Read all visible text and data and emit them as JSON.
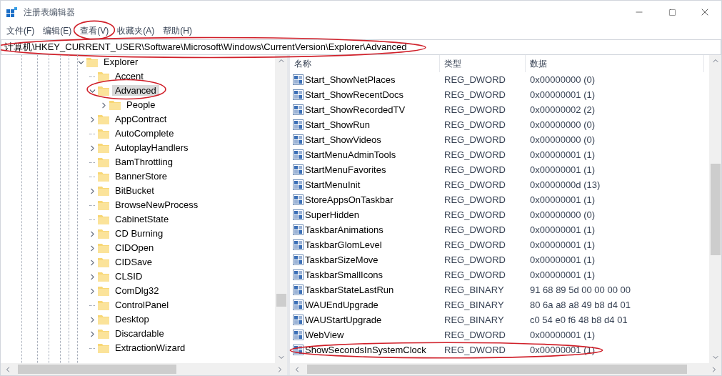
{
  "window": {
    "title": "注册表编辑器"
  },
  "menu": [
    {
      "label": "文件(F)",
      "circled": false
    },
    {
      "label": "编辑(E)",
      "circled": false
    },
    {
      "label": "查看(V)",
      "circled": true
    },
    {
      "label": "收藏夹(A)",
      "circled": false
    },
    {
      "label": "帮助(H)",
      "circled": false
    }
  ],
  "address": {
    "value": "计算机\\HKEY_CURRENT_USER\\Software\\Microsoft\\Windows\\CurrentVersion\\Explorer\\Advanced",
    "circled": true
  },
  "tree": [
    {
      "label": "Explorer",
      "kind": "branch",
      "expanded": true,
      "selected": false,
      "circled": false,
      "children": [
        {
          "label": "Accent",
          "kind": "leaf",
          "selected": false,
          "circled": false
        },
        {
          "label": "Advanced",
          "kind": "branch",
          "expanded": true,
          "selected": true,
          "circled": true,
          "children": [
            {
              "label": "People",
              "kind": "branch",
              "expanded": false,
              "selected": false,
              "circled": false
            }
          ]
        },
        {
          "label": "AppContract",
          "kind": "branch",
          "expanded": false,
          "selected": false,
          "circled": false
        },
        {
          "label": "AutoComplete",
          "kind": "leaf",
          "selected": false,
          "circled": false
        },
        {
          "label": "AutoplayHandlers",
          "kind": "branch",
          "expanded": false,
          "selected": false,
          "circled": false
        },
        {
          "label": "BamThrottling",
          "kind": "leaf",
          "selected": false,
          "circled": false
        },
        {
          "label": "BannerStore",
          "kind": "leaf",
          "selected": false,
          "circled": false
        },
        {
          "label": "BitBucket",
          "kind": "branch",
          "expanded": false,
          "selected": false,
          "circled": false
        },
        {
          "label": "BrowseNewProcess",
          "kind": "leaf",
          "selected": false,
          "circled": false
        },
        {
          "label": "CabinetState",
          "kind": "leaf",
          "selected": false,
          "circled": false
        },
        {
          "label": "CD Burning",
          "kind": "branch",
          "expanded": false,
          "selected": false,
          "circled": false
        },
        {
          "label": "CIDOpen",
          "kind": "branch",
          "expanded": false,
          "selected": false,
          "circled": false
        },
        {
          "label": "CIDSave",
          "kind": "branch",
          "expanded": false,
          "selected": false,
          "circled": false
        },
        {
          "label": "CLSID",
          "kind": "branch",
          "expanded": false,
          "selected": false,
          "circled": false
        },
        {
          "label": "ComDlg32",
          "kind": "branch",
          "expanded": false,
          "selected": false,
          "circled": false
        },
        {
          "label": "ControlPanel",
          "kind": "leaf",
          "selected": false,
          "circled": false
        },
        {
          "label": "Desktop",
          "kind": "branch",
          "expanded": false,
          "selected": false,
          "circled": false
        },
        {
          "label": "Discardable",
          "kind": "branch",
          "expanded": false,
          "selected": false,
          "circled": false
        },
        {
          "label": "ExtractionWizard",
          "kind": "leaf",
          "selected": false,
          "circled": false
        }
      ]
    }
  ],
  "table": {
    "columns": [
      "名称",
      "类型",
      "数据"
    ],
    "rows": [
      {
        "name": "Start_ShowNetPlaces",
        "type": "REG_DWORD",
        "data": "0x00000000 (0)",
        "circled": false
      },
      {
        "name": "Start_ShowRecentDocs",
        "type": "REG_DWORD",
        "data": "0x00000001 (1)",
        "circled": false
      },
      {
        "name": "Start_ShowRecordedTV",
        "type": "REG_DWORD",
        "data": "0x00000002 (2)",
        "circled": false
      },
      {
        "name": "Start_ShowRun",
        "type": "REG_DWORD",
        "data": "0x00000000 (0)",
        "circled": false
      },
      {
        "name": "Start_ShowVideos",
        "type": "REG_DWORD",
        "data": "0x00000000 (0)",
        "circled": false
      },
      {
        "name": "StartMenuAdminTools",
        "type": "REG_DWORD",
        "data": "0x00000001 (1)",
        "circled": false
      },
      {
        "name": "StartMenuFavorites",
        "type": "REG_DWORD",
        "data": "0x00000001 (1)",
        "circled": false
      },
      {
        "name": "StartMenuInit",
        "type": "REG_DWORD",
        "data": "0x0000000d (13)",
        "circled": false
      },
      {
        "name": "StoreAppsOnTaskbar",
        "type": "REG_DWORD",
        "data": "0x00000001 (1)",
        "circled": false
      },
      {
        "name": "SuperHidden",
        "type": "REG_DWORD",
        "data": "0x00000000 (0)",
        "circled": false
      },
      {
        "name": "TaskbarAnimations",
        "type": "REG_DWORD",
        "data": "0x00000001 (1)",
        "circled": false
      },
      {
        "name": "TaskbarGlomLevel",
        "type": "REG_DWORD",
        "data": "0x00000001 (1)",
        "circled": false
      },
      {
        "name": "TaskbarSizeMove",
        "type": "REG_DWORD",
        "data": "0x00000001 (1)",
        "circled": false
      },
      {
        "name": "TaskbarSmallIcons",
        "type": "REG_DWORD",
        "data": "0x00000001 (1)",
        "circled": false
      },
      {
        "name": "TaskbarStateLastRun",
        "type": "REG_BINARY",
        "data": "91 68 89 5d 00 00 00 00",
        "circled": false
      },
      {
        "name": "WAUEndUpgrade",
        "type": "REG_BINARY",
        "data": "80 6a a8 a8 49 b8 d4 01",
        "circled": false
      },
      {
        "name": "WAUStartUpgrade",
        "type": "REG_BINARY",
        "data": "c0 54 e0 f6 48 b8 d4 01",
        "circled": false
      },
      {
        "name": "WebView",
        "type": "REG_DWORD",
        "data": "0x00000001 (1)",
        "circled": false
      },
      {
        "name": "ShowSecondsInSystemClock",
        "type": "REG_DWORD",
        "data": "0x00000001 (1)",
        "circled": true
      }
    ]
  }
}
